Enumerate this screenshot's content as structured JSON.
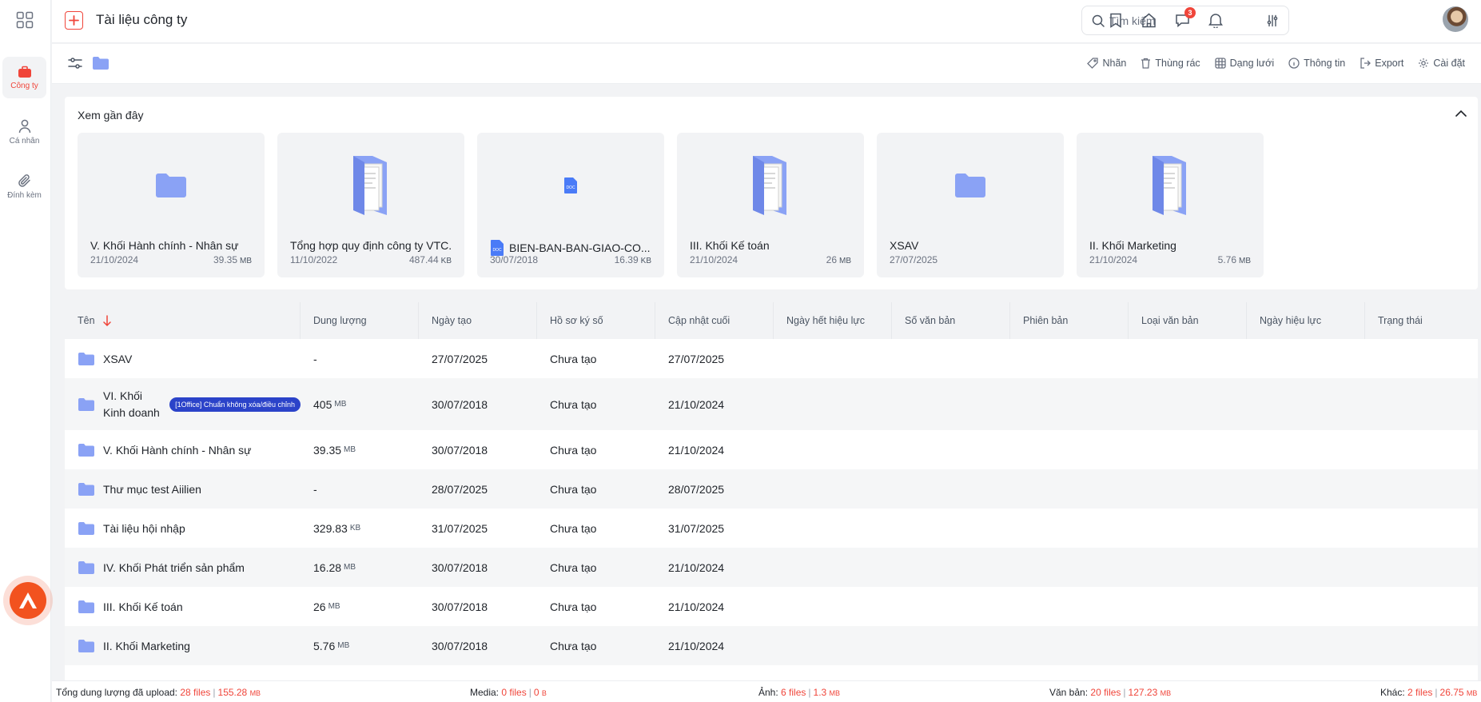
{
  "app": {
    "title": "Tài liệu công ty"
  },
  "sidebar": {
    "items": [
      {
        "label": "Công ty",
        "icon": "briefcase-icon",
        "active": true
      },
      {
        "label": "Cá nhân",
        "icon": "user-icon",
        "active": false
      },
      {
        "label": "Đính kèm",
        "icon": "paperclip-icon",
        "active": false
      }
    ]
  },
  "search": {
    "placeholder": "Tìm kiếm",
    "value": ""
  },
  "notifications": {
    "count": "3"
  },
  "toolbar": {
    "actions": [
      {
        "label": "Nhãn",
        "icon": "tag-icon"
      },
      {
        "label": "Thùng rác",
        "icon": "trash-icon"
      },
      {
        "label": "Dạng lưới",
        "icon": "grid-icon"
      },
      {
        "label": "Thông tin",
        "icon": "info-icon"
      },
      {
        "label": "Export",
        "icon": "export-icon"
      },
      {
        "label": "Cài đặt",
        "icon": "settings-icon"
      }
    ]
  },
  "recent": {
    "title": "Xem gần đây",
    "items": [
      {
        "name": "V. Khối Hành chính - Nhân sự",
        "date": "21/10/2024",
        "size": "39.35",
        "unit": "MB",
        "kind": "folder"
      },
      {
        "name": "Tổng hợp quy định công ty VTC...",
        "date": "11/10/2022",
        "size": "487.44",
        "unit": "KB",
        "kind": "folder-docs"
      },
      {
        "name": "BIEN-BAN-BAN-GIAO-CO...",
        "date": "30/07/2018",
        "size": "16.39",
        "unit": "KB",
        "kind": "doc"
      },
      {
        "name": "III. Khối Kế toán",
        "date": "21/10/2024",
        "size": "26",
        "unit": "MB",
        "kind": "folder-docs"
      },
      {
        "name": "XSAV",
        "date": "27/07/2025",
        "size": "",
        "unit": "",
        "kind": "folder"
      },
      {
        "name": "II. Khối Marketing",
        "date": "21/10/2024",
        "size": "5.76",
        "unit": "MB",
        "kind": "folder-docs"
      }
    ]
  },
  "table": {
    "columns": [
      "Tên",
      "Dung lượng",
      "Ngày tạo",
      "Hồ sơ ký số",
      "Cập nhật cuối",
      "Ngày hết hiệu lực",
      "Số văn bản",
      "Phiên bản",
      "Loại văn bản",
      "Ngày hiệu lực",
      "Trạng thái"
    ],
    "rows": [
      {
        "name": "XSAV",
        "size": "-",
        "unit": "",
        "created": "27/07/2025",
        "sign": "Chưa tạo",
        "updated": "27/07/2025",
        "tag": ""
      },
      {
        "name": "VI. Khối Kinh doanh",
        "size": "405",
        "unit": "MB",
        "created": "30/07/2018",
        "sign": "Chưa tạo",
        "updated": "21/10/2024",
        "tag": "[1Office] Chuẩn không xóa/điều chỉnh"
      },
      {
        "name": "V. Khối Hành chính - Nhân sự",
        "size": "39.35",
        "unit": "MB",
        "created": "30/07/2018",
        "sign": "Chưa tạo",
        "updated": "21/10/2024",
        "tag": ""
      },
      {
        "name": "Thư mục test Aiilien",
        "size": "-",
        "unit": "",
        "created": "28/07/2025",
        "sign": "Chưa tạo",
        "updated": "28/07/2025",
        "tag": ""
      },
      {
        "name": "Tài liệu hội nhập",
        "size": "329.83",
        "unit": "KB",
        "created": "31/07/2025",
        "sign": "Chưa tạo",
        "updated": "31/07/2025",
        "tag": ""
      },
      {
        "name": "IV. Khối Phát triển sản phẩm",
        "size": "16.28",
        "unit": "MB",
        "created": "30/07/2018",
        "sign": "Chưa tạo",
        "updated": "21/10/2024",
        "tag": ""
      },
      {
        "name": "III. Khối Kế toán",
        "size": "26",
        "unit": "MB",
        "created": "30/07/2018",
        "sign": "Chưa tạo",
        "updated": "21/10/2024",
        "tag": ""
      },
      {
        "name": "II. Khối Marketing",
        "size": "5.76",
        "unit": "MB",
        "created": "30/07/2018",
        "sign": "Chưa tạo",
        "updated": "21/10/2024",
        "tag": ""
      }
    ]
  },
  "footer": {
    "total": {
      "label": "Tổng dung lượng đã upload:",
      "files": "28 files",
      "size": "155.28",
      "unit": "MB"
    },
    "media": {
      "label": "Media:",
      "files": "0 files",
      "size": "0",
      "unit": "B"
    },
    "image": {
      "label": "Ảnh:",
      "files": "6 files",
      "size": "1.3",
      "unit": "MB"
    },
    "document": {
      "label": "Văn bản:",
      "files": "20 files",
      "size": "127.23",
      "unit": "MB"
    },
    "other": {
      "label": "Khác:",
      "files": "2 files",
      "size": "26.75",
      "unit": "MB"
    }
  },
  "colors": {
    "accent": "#f0453a",
    "folder": "#8aa2f5",
    "tag": "#2b43c9",
    "fab": "#f2521f"
  }
}
